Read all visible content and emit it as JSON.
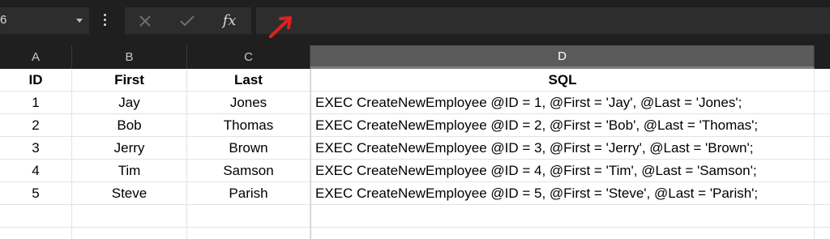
{
  "formula_bar": {
    "name_box": "6",
    "fx_label": "fx",
    "formula_value": ""
  },
  "columns": [
    "A",
    "B",
    "C",
    "D"
  ],
  "sheet": {
    "headers": [
      "ID",
      "First",
      "Last",
      "SQL"
    ],
    "rows": [
      [
        "1",
        "Jay",
        "Jones",
        "EXEC CreateNewEmployee @ID = 1, @First = 'Jay', @Last = 'Jones';"
      ],
      [
        "2",
        "Bob",
        "Thomas",
        "EXEC CreateNewEmployee @ID = 2, @First = 'Bob', @Last = 'Thomas';"
      ],
      [
        "3",
        "Jerry",
        "Brown",
        "EXEC CreateNewEmployee @ID = 3, @First = 'Jerry', @Last = 'Brown';"
      ],
      [
        "4",
        "Tim",
        "Samson",
        "EXEC CreateNewEmployee @ID = 4, @First = 'Tim', @Last = 'Samson';"
      ],
      [
        "5",
        "Steve",
        "Parish",
        "EXEC CreateNewEmployee @ID = 5, @First = 'Steve', @Last = 'Parish';"
      ]
    ]
  },
  "colors": {
    "toolbar_bg": "#1f1f1f",
    "control_bg": "#2d2d2d",
    "selected_column_bg": "#5a5a5a",
    "annotation_arrow": "#e02020"
  },
  "icons": {
    "cancel": "close-icon",
    "enter": "check-icon",
    "insert_function": "fx-icon",
    "more": "vertical-ellipsis-icon",
    "annotation": "red-arrow-icon"
  }
}
